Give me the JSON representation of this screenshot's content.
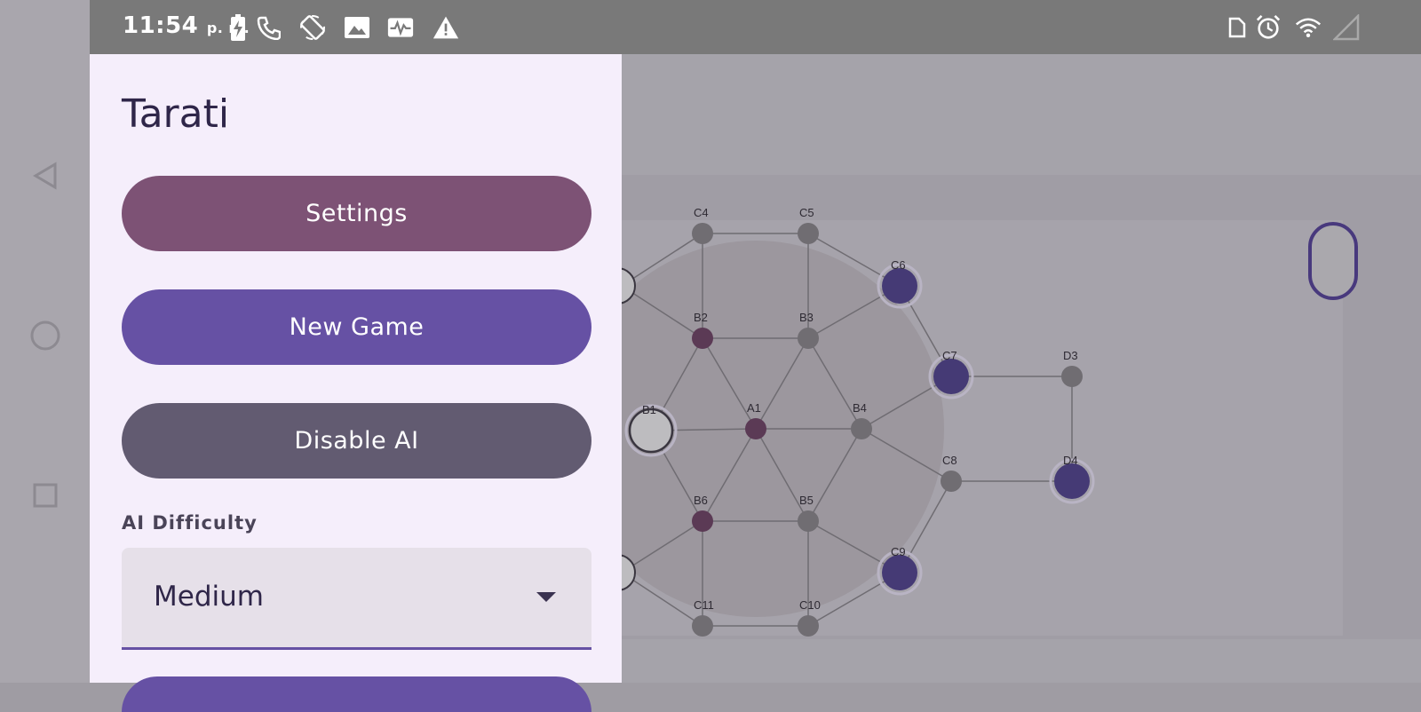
{
  "status_bar": {
    "time": "11:54",
    "ampm": "p. m.",
    "left_icons": [
      "battery-charging-icon",
      "phone-icon",
      "screen-rotate-icon",
      "image-icon",
      "activity-icon",
      "warning-icon"
    ],
    "right_icons": [
      "nfc-icon",
      "alarm-icon",
      "wifi-icon",
      "cell-signal-icon"
    ]
  },
  "nav_bar": {
    "icons": [
      "back-icon",
      "home-icon",
      "recents-icon"
    ]
  },
  "drawer": {
    "title": "Tarati",
    "settings_label": "Settings",
    "new_game_label": "New Game",
    "disable_ai_label": "Disable AI",
    "difficulty_label": "AI Difficulty",
    "difficulty_value": "Medium"
  },
  "board": {
    "nodes": [
      {
        "id": "A1",
        "label": "A1",
        "state": "purple-small"
      },
      {
        "id": "B1",
        "label": "B1",
        "state": "white-piece"
      },
      {
        "id": "B2",
        "label": "B2",
        "state": "purple-small"
      },
      {
        "id": "B3",
        "label": "B3",
        "state": "empty"
      },
      {
        "id": "B4",
        "label": "B4",
        "state": "empty"
      },
      {
        "id": "B5",
        "label": "B5",
        "state": "empty"
      },
      {
        "id": "B6",
        "label": "B6",
        "state": "purple-small"
      },
      {
        "id": "C4",
        "label": "C4",
        "state": "empty"
      },
      {
        "id": "C5",
        "label": "C5",
        "state": "empty"
      },
      {
        "id": "C6",
        "label": "C6",
        "state": "indigo-piece"
      },
      {
        "id": "C7",
        "label": "C7",
        "state": "indigo-piece"
      },
      {
        "id": "C8",
        "label": "C8",
        "state": "empty"
      },
      {
        "id": "C9",
        "label": "C9",
        "state": "indigo-piece"
      },
      {
        "id": "C10",
        "label": "C10",
        "state": "empty"
      },
      {
        "id": "C11",
        "label": "C11",
        "state": "empty"
      },
      {
        "id": "D3",
        "label": "D3",
        "state": "empty"
      },
      {
        "id": "D4",
        "label": "D4",
        "state": "indigo-piece"
      }
    ],
    "colors": {
      "empty": "#706d72",
      "purple_small": "#5b3a55",
      "indigo": "#453a75",
      "white": "#bdbcbf",
      "line": "#6f6c72"
    }
  }
}
